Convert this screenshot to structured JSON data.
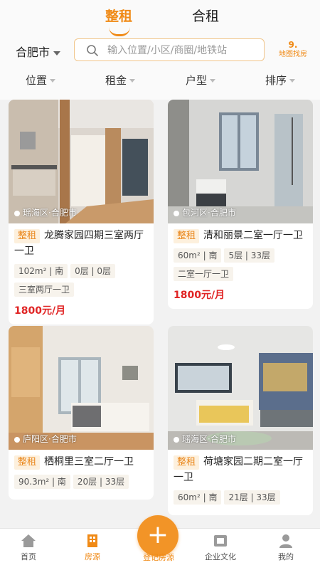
{
  "header": {
    "tabs": [
      {
        "label": "整租"
      },
      {
        "label": "合租"
      }
    ],
    "city": "合肥市",
    "search_placeholder": "输入位置/小区/商圈/地铁站",
    "map_button": "地图找房"
  },
  "filters": [
    "位置",
    "租金",
    "户型",
    "排序"
  ],
  "listings": [
    {
      "badge": "整租",
      "title": "龙腾家园四期三室两厅一卫",
      "location": "瑶海区·合肥市",
      "tags": [
        "102m² | 南",
        "0层 | 0层",
        "三室两厅一卫"
      ],
      "price": "1800元/月"
    },
    {
      "badge": "整租",
      "title": "清和丽景二室一厅一卫",
      "location": "包河区·合肥市",
      "tags": [
        "60m² | 南",
        "5层 | 33层",
        "二室一厅一卫"
      ],
      "price": "1800元/月"
    },
    {
      "badge": "整租",
      "title": "栖桐里三室二厅一卫",
      "location": "庐阳区·合肥市",
      "tags": [
        "90.3m² | 南",
        "20层 | 33层"
      ],
      "price": ""
    },
    {
      "badge": "整租",
      "title": "荷塘家园二期二室一厅一卫",
      "location": "瑶海区·合肥市",
      "tags": [
        "60m² | 南",
        "21层 | 33层"
      ],
      "price": ""
    }
  ],
  "tabbar": {
    "items": [
      {
        "label": "首页",
        "icon": "home-icon"
      },
      {
        "label": "房源",
        "icon": "building-icon"
      },
      {
        "label": "登记房源",
        "icon": "plus-icon"
      },
      {
        "label": "企业文化",
        "icon": "culture-icon"
      },
      {
        "label": "我的",
        "icon": "user-icon"
      }
    ],
    "fab_symbol": "+"
  },
  "colors": {
    "accent": "#f08a16",
    "price": "#e02424",
    "badge_bg": "#fdf0dd"
  }
}
